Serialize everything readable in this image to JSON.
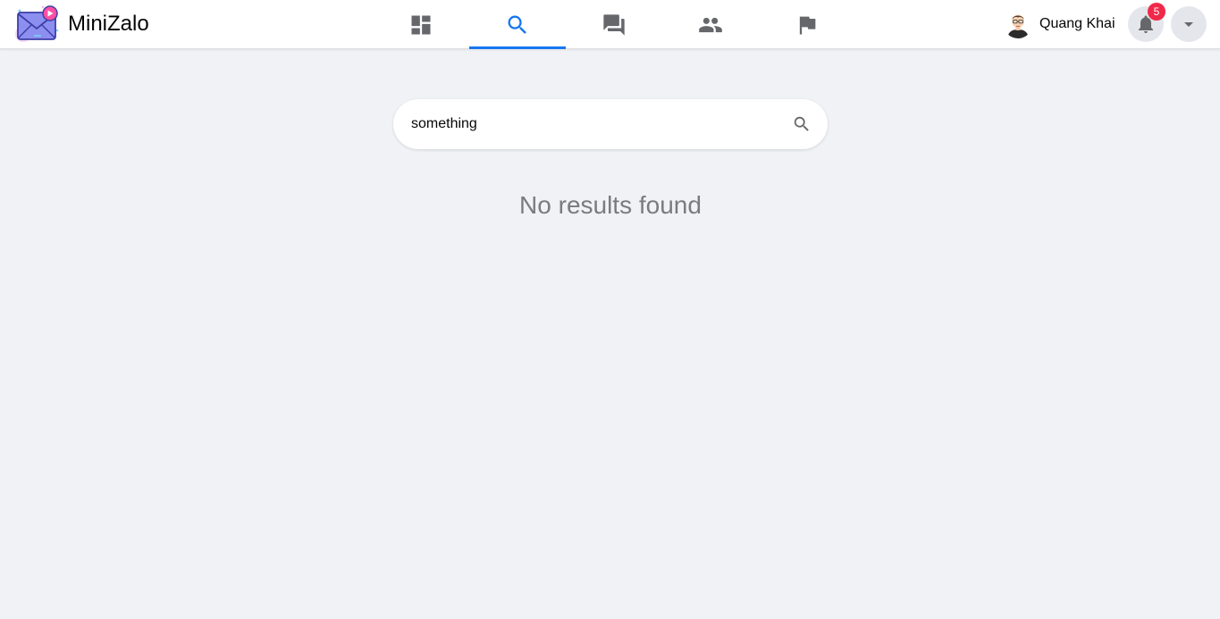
{
  "app": {
    "name": "MiniZalo",
    "logo_icon": "envelope-logo-icon"
  },
  "nav": {
    "tabs": [
      {
        "name": "dashboard",
        "icon": "dashboard-icon",
        "active": false
      },
      {
        "name": "search",
        "icon": "search-icon",
        "active": true
      },
      {
        "name": "messages",
        "icon": "chat-bubbles-icon",
        "active": false
      },
      {
        "name": "friends",
        "icon": "people-icon",
        "active": false
      },
      {
        "name": "reports",
        "icon": "flag-icon",
        "active": false
      }
    ],
    "active_color": "#1877f2",
    "inactive_color": "#65676b"
  },
  "user": {
    "name": "Quang Khai",
    "avatar_icon": "user-avatar"
  },
  "notifications": {
    "count": "5",
    "icon": "bell-icon",
    "badge_color": "#f02849"
  },
  "account_menu": {
    "icon": "caret-down-icon"
  },
  "search": {
    "value": "something",
    "icon": "search-icon"
  },
  "results": {
    "empty_message": "No results found"
  }
}
